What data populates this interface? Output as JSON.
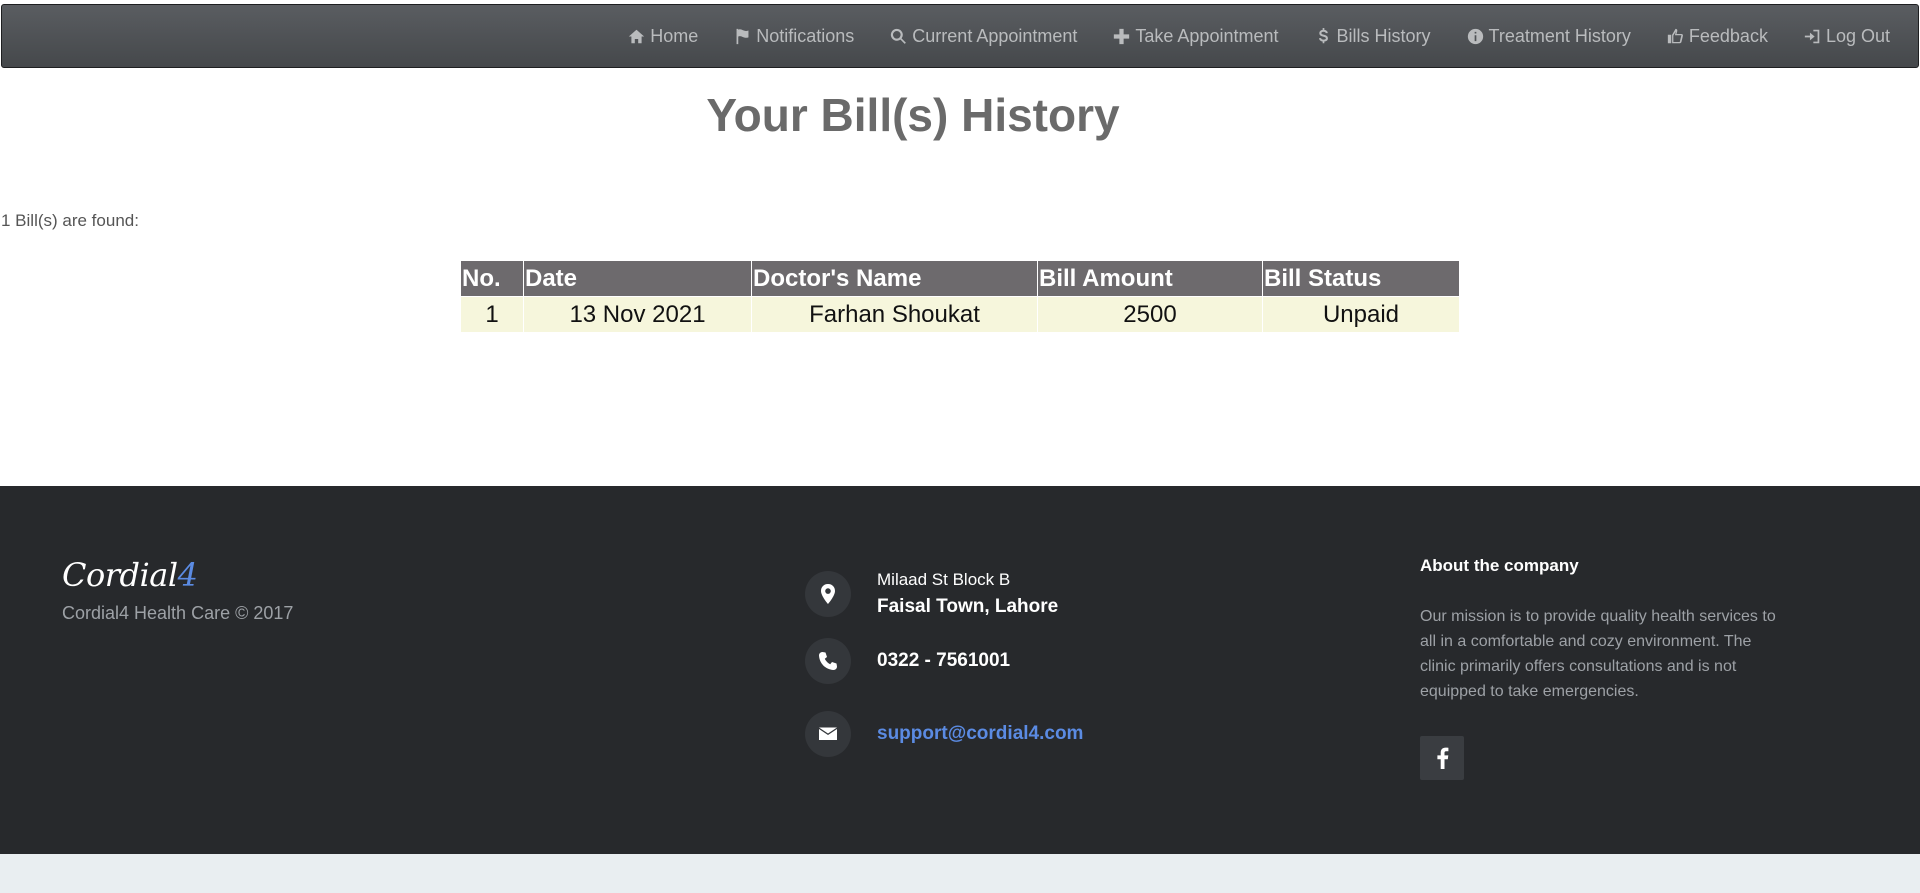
{
  "nav": {
    "items": [
      {
        "label": "Home",
        "icon": "home-icon"
      },
      {
        "label": "Notifications",
        "icon": "flag-icon"
      },
      {
        "label": "Current Appointment",
        "icon": "search-icon"
      },
      {
        "label": "Take Appointment",
        "icon": "plus-icon"
      },
      {
        "label": "Bills History",
        "icon": "dollar-icon"
      },
      {
        "label": "Treatment History",
        "icon": "info-icon"
      },
      {
        "label": "Feedback",
        "icon": "thumbs-up-icon"
      },
      {
        "label": "Log Out",
        "icon": "log-out-icon"
      }
    ]
  },
  "page": {
    "title": "Your Bill(s) History",
    "found_text": "1 Bill(s) are found:"
  },
  "table": {
    "headers": [
      "No.",
      "Date",
      "Doctor's Name",
      "Bill Amount",
      "Bill Status"
    ],
    "rows": [
      [
        "1",
        "13 Nov 2021",
        "Farhan Shoukat",
        "2500",
        "Unpaid"
      ]
    ]
  },
  "footer": {
    "logo_main": "Cordial",
    "logo_accent": "4",
    "copyright": "Cordial4 Health Care © 2017",
    "address_line1": "Milaad St Block B",
    "address_line2": "Faisal Town, Lahore",
    "phone": "0322 - 7561001",
    "email": "support@cordial4.com",
    "about_title": "About the company",
    "about_text": "Our mission is to provide quality health services to all in a comfortable and cozy environment. The clinic primarily offers consultations and is not equipped to take emergencies.",
    "social_icon": "facebook-icon"
  },
  "colors": {
    "navbar": "#4e5154",
    "table_header": "#6d6a6d",
    "table_row": "#f6f6dc",
    "footer": "#27292c",
    "accent": "#5b8be3"
  }
}
